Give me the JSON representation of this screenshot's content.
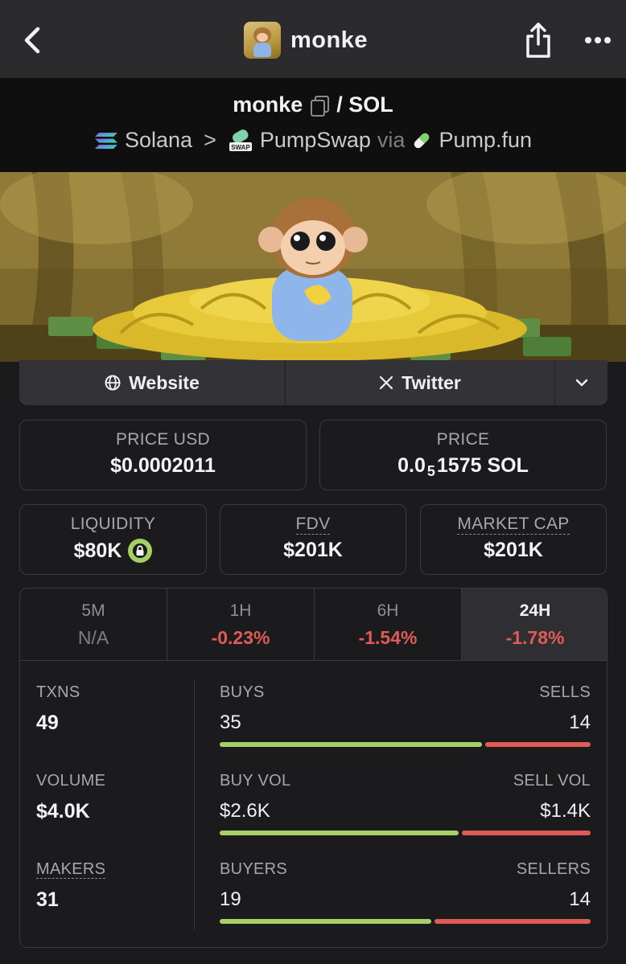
{
  "topbar": {
    "title": "monke"
  },
  "pair": {
    "base": "monke",
    "quote": "/ SOL",
    "chain": "Solana",
    "dex": "PumpSwap",
    "via": "via",
    "launchpad": "Pump.fun",
    "swap_badge": "SWAP"
  },
  "links": {
    "website": "Website",
    "twitter": "Twitter"
  },
  "stats": {
    "price_usd_label": "PRICE USD",
    "price_usd": "$0.0002011",
    "price_label": "PRICE",
    "price_prefix": "0.0",
    "price_zeros": "5",
    "price_suffix": "1575 SOL",
    "liquidity_label": "LIQUIDITY",
    "liquidity": "$80K",
    "fdv_label": "FDV",
    "fdv": "$201K",
    "mcap_label": "MARKET CAP",
    "mcap": "$201K"
  },
  "periods": [
    {
      "label": "5M",
      "change": "N/A"
    },
    {
      "label": "1H",
      "change": "-0.23%"
    },
    {
      "label": "6H",
      "change": "-1.54%"
    },
    {
      "label": "24H",
      "change": "-1.78%",
      "active": true
    }
  ],
  "metrics": {
    "txns_label": "TXNS",
    "txns": "49",
    "volume_label": "VOLUME",
    "volume": "$4.0K",
    "makers_label": "MAKERS",
    "makers": "31"
  },
  "ratios": {
    "buys_label": "BUYS",
    "buys": "35",
    "sells_label": "SELLS",
    "sells": "14",
    "buy_vol_label": "BUY VOL",
    "buy_vol": "$2.6K",
    "sell_vol_label": "SELL VOL",
    "sell_vol": "$1.4K",
    "buyers_label": "BUYERS",
    "buyers": "19",
    "sellers_label": "SELLERS",
    "sellers": "14",
    "buys_fraction": 0.714,
    "buy_vol_fraction": 0.65,
    "buyers_fraction": 0.576
  },
  "colors": {
    "buy": "#a6d064",
    "sell": "#e05b56",
    "accent": "#a6d064"
  },
  "icons": [
    "back-icon",
    "share-icon",
    "more-icon",
    "copy-icon",
    "solana-icon",
    "pumpswap-icon",
    "pill-icon",
    "globe-icon",
    "x-icon",
    "chevron-down-icon",
    "lock-icon"
  ]
}
